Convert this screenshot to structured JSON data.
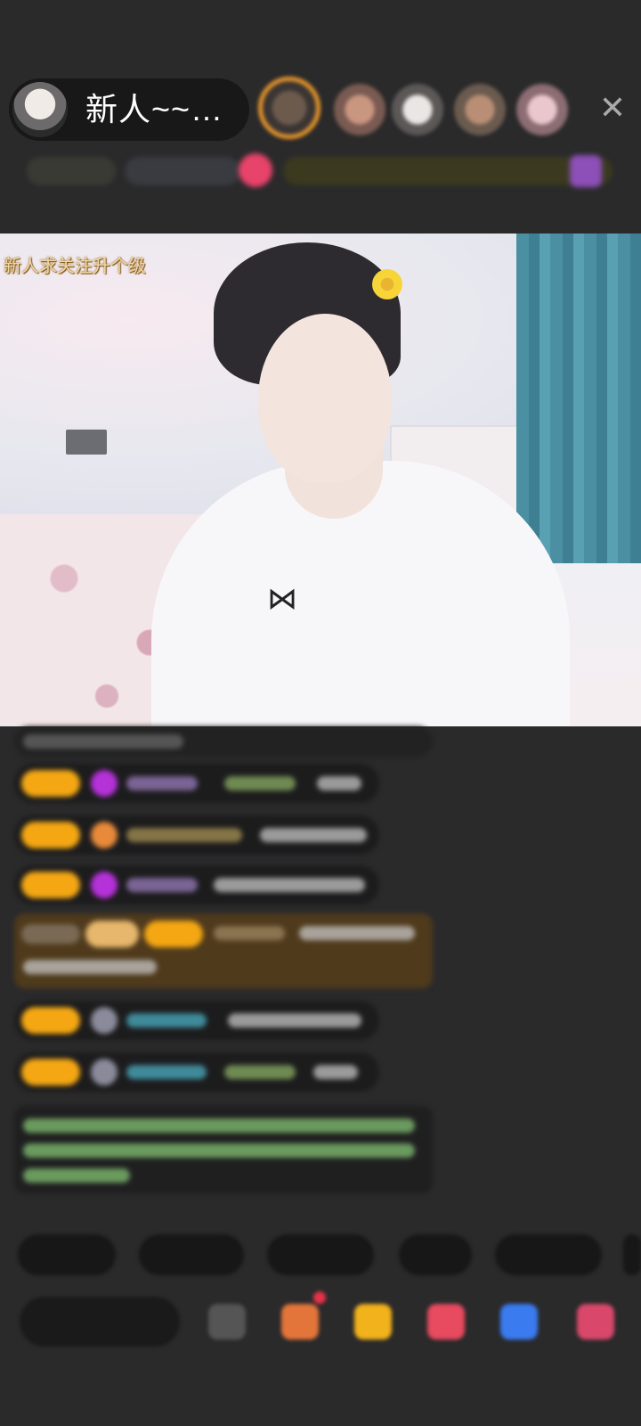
{
  "header": {
    "host_name": "新人~~…",
    "close_icon": "close-icon"
  },
  "video": {
    "overlay_text": "新人求关注升个级"
  },
  "colors": {
    "background": "#2a2a2b",
    "gift_badge": "#f4a713",
    "overlay_text": "#f3d7a2"
  }
}
